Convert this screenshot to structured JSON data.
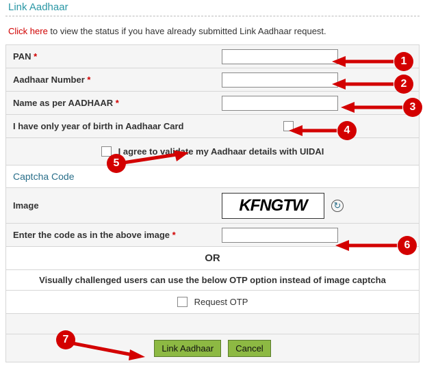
{
  "title": "Link Aadhaar",
  "status": {
    "click_here": "Click here",
    "rest": " to view the status if you have already submitted Link Aadhaar request."
  },
  "fields": {
    "pan_label": "PAN",
    "aadhaar_no_label": "Aadhaar Number",
    "name_label": "Name as per AADHAAR",
    "yob_label": "I have only year of birth in Aadhaar Card",
    "consent_label": "I agree to validate my Aadhaar details with UIDAI"
  },
  "captcha": {
    "heading": "Captcha Code",
    "image_label": "Image",
    "image_text": "KFNGTW",
    "enter_label": "Enter the code as in the above image",
    "or": "OR",
    "vc_text": "Visually challenged users can use the below OTP option instead of image captcha",
    "request_otp": "Request OTP"
  },
  "buttons": {
    "link": "Link Aadhaar",
    "cancel": "Cancel"
  },
  "annotations": {
    "b1": "1",
    "b2": "2",
    "b3": "3",
    "b4": "4",
    "b5": "5",
    "b6": "6",
    "b7": "7"
  }
}
